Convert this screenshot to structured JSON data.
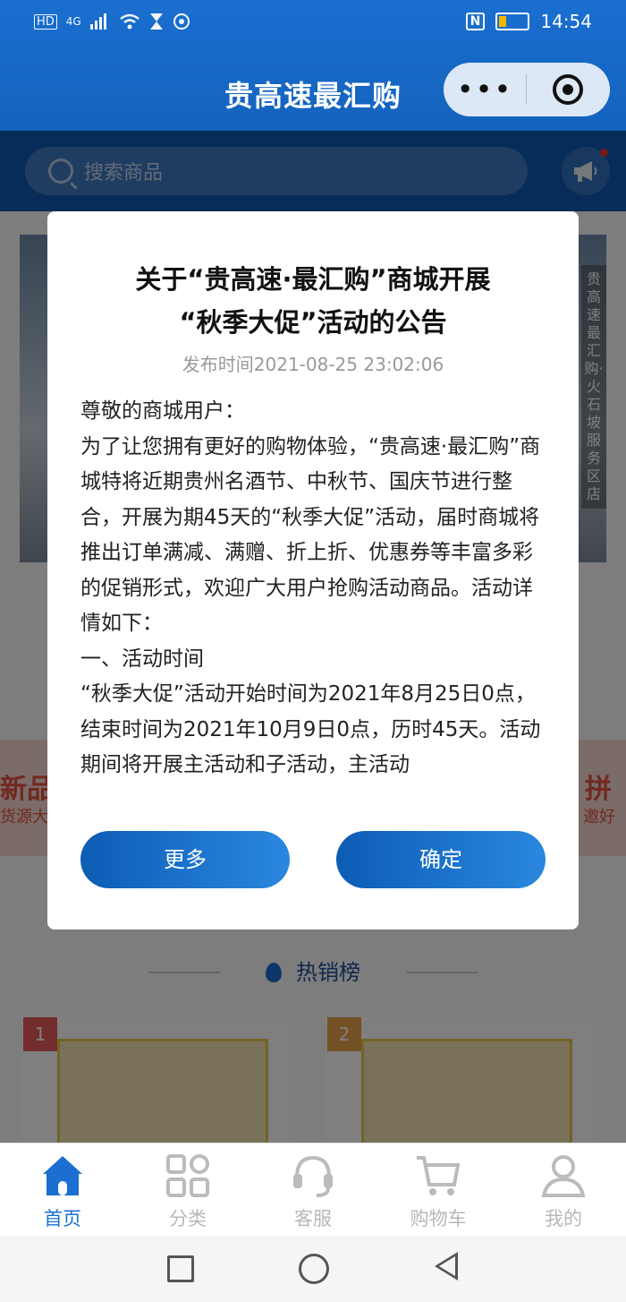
{
  "status_bar": {
    "left_icons": [
      "HD",
      "4G",
      "signal-icon",
      "wifi-icon",
      "hourglass-icon",
      "location-icon"
    ],
    "time": "14:54",
    "nfc": "N"
  },
  "header": {
    "title": "贵高速最汇购",
    "menu_dots": "•••"
  },
  "search": {
    "placeholder": "搜索商品"
  },
  "background": {
    "banner_label": "贵高速最汇购·火石坡服务区店",
    "promo_left_title": "新品预",
    "promo_left_sub": "货源大",
    "promo_right_title": "拼",
    "promo_right_sub": "邀好",
    "hot_title": "热销榜",
    "cards": [
      {
        "rank": "1"
      },
      {
        "rank": "2"
      }
    ]
  },
  "modal": {
    "title_line1": "关于“贵高速·最汇购”商城开展",
    "title_line2": "“秋季大促”活动的公告",
    "time": "发布时间2021-08-25 23:02:06",
    "paragraphs": [
      "尊敬的商城用户：",
      "为了让您拥有更好的购物体验，“贵高速·最汇购”商城特将近期贵州名酒节、中秋节、国庆节进行整合，开展为期45天的“秋季大促”活动，届时商城将推出订单满减、满赠、折上折、优惠券等丰富多彩的促销形式，欢迎广大用户抢购活动商品。活动详情如下：",
      "一、活动时间",
      "“秋季大促”活动开始时间为2021年8月25日0点，结束时间为2021年10月9日0点，历时45天。活动期间将开展主活动和子活动，主活动"
    ],
    "more_button": "更多",
    "ok_button": "确定"
  },
  "tabbar": {
    "items": [
      {
        "label": "首页",
        "icon": "home-icon",
        "active": true
      },
      {
        "label": "分类",
        "icon": "grid-icon",
        "active": false
      },
      {
        "label": "客服",
        "icon": "headset-icon",
        "active": false
      },
      {
        "label": "购物车",
        "icon": "cart-icon",
        "active": false
      },
      {
        "label": "我的",
        "icon": "user-icon",
        "active": false
      }
    ]
  },
  "colors": {
    "primary": "#1a6fd0",
    "header_dark": "#0e58b3",
    "inactive_tab": "#b8b8b8"
  }
}
